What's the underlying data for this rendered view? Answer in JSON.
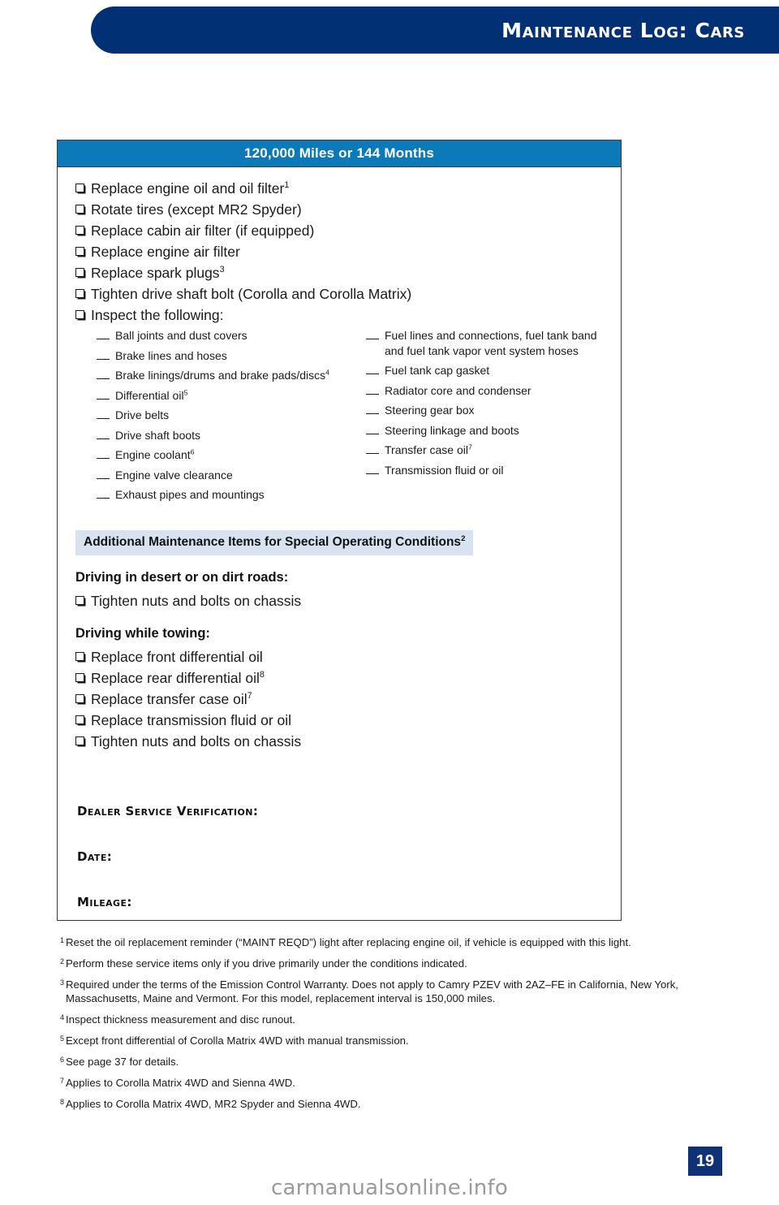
{
  "header": {
    "title": "Maintenance Log: Cars"
  },
  "service_box": {
    "interval_title": "120,000 Miles or 144 Months",
    "main_items": [
      {
        "text": "Replace engine oil and oil filter",
        "footnote": "1"
      },
      {
        "text": "Rotate tires (except MR2 Spyder)",
        "footnote": ""
      },
      {
        "text": "Replace cabin air filter (if equipped)",
        "footnote": ""
      },
      {
        "text": "Replace engine air filter",
        "footnote": ""
      },
      {
        "text": "Replace spark plugs",
        "footnote": "3"
      },
      {
        "text": "Tighten drive shaft bolt (Corolla and Corolla Matrix)",
        "footnote": ""
      },
      {
        "text": "Inspect the following:",
        "footnote": ""
      }
    ],
    "inspect_left": [
      {
        "text": "Ball joints and dust covers",
        "footnote": ""
      },
      {
        "text": "Brake lines and hoses",
        "footnote": ""
      },
      {
        "text": "Brake linings/drums and brake pads/discs",
        "footnote": "4"
      },
      {
        "text": "Differential oil",
        "footnote": "5"
      },
      {
        "text": "Drive belts",
        "footnote": ""
      },
      {
        "text": "Drive shaft boots",
        "footnote": ""
      },
      {
        "text": "Engine coolant",
        "footnote": "6"
      },
      {
        "text": "Engine valve clearance",
        "footnote": ""
      },
      {
        "text": "Exhaust pipes and mountings",
        "footnote": ""
      }
    ],
    "inspect_right": [
      {
        "text": "Fuel lines and connections, fuel tank band and fuel tank vapor vent system hoses",
        "footnote": ""
      },
      {
        "text": "Fuel tank cap gasket",
        "footnote": ""
      },
      {
        "text": "Radiator core and condenser",
        "footnote": ""
      },
      {
        "text": "Steering gear box",
        "footnote": ""
      },
      {
        "text": "Steering linkage and boots",
        "footnote": ""
      },
      {
        "text": "Transfer case oil",
        "footnote": "7"
      },
      {
        "text": "Transmission fluid or oil",
        "footnote": ""
      }
    ],
    "additional_bar": {
      "text": "Additional Maintenance Items for Special Operating Conditions",
      "footnote": "2"
    },
    "conditions": [
      {
        "heading": "Driving in desert or on dirt roads:",
        "items": [
          {
            "text": "Tighten nuts and bolts on chassis",
            "footnote": ""
          }
        ]
      },
      {
        "heading": "Driving while towing:",
        "items": [
          {
            "text": "Replace front differential oil",
            "footnote": ""
          },
          {
            "text": "Replace rear differential oil",
            "footnote": "8"
          },
          {
            "text": "Replace transfer case oil",
            "footnote": "7"
          },
          {
            "text": "Replace transmission fluid or oil",
            "footnote": ""
          },
          {
            "text": "Tighten nuts and bolts on chassis",
            "footnote": ""
          }
        ]
      }
    ],
    "verification": {
      "dealer_label": "Dealer Service Verification:",
      "date_label": "Date:",
      "mileage_label": "Mileage:"
    }
  },
  "footnotes": [
    {
      "mark": "1",
      "text": "Reset the oil replacement reminder (“MAINT REQD”) light after replacing engine oil, if vehicle is equipped with this light."
    },
    {
      "mark": "2",
      "text": "Perform these service items only if you drive primarily under the conditions indicated."
    },
    {
      "mark": "3",
      "text": "Required under the terms of the Emission Control Warranty. Does not apply to Camry PZEV with 2AZ–FE in California, New York, Massachusetts, Maine and Vermont. For this model, replacement interval is 150,000 miles."
    },
    {
      "mark": "4",
      "text": "Inspect thickness measurement and disc runout."
    },
    {
      "mark": "5",
      "text": "Except front differential of Corolla Matrix 4WD with manual transmission."
    },
    {
      "mark": "6",
      "text": "See page 37 for details."
    },
    {
      "mark": "7",
      "text": "Applies to Corolla Matrix 4WD and Sienna 4WD."
    },
    {
      "mark": "8",
      "text": "Applies to Corolla Matrix 4WD, MR2 Spyder and Sienna 4WD."
    }
  ],
  "page": {
    "number": "19",
    "watermark": "carmanualsonline.info"
  },
  "colors": {
    "header_navy": "#013174",
    "interval_blue": "#0c7ab8",
    "additional_lightblue": "#d7e3f0",
    "page_badge_blue": "#0f3277",
    "text_dark": "#1a1a1a",
    "watermark_gray": "#9a9a9a"
  }
}
